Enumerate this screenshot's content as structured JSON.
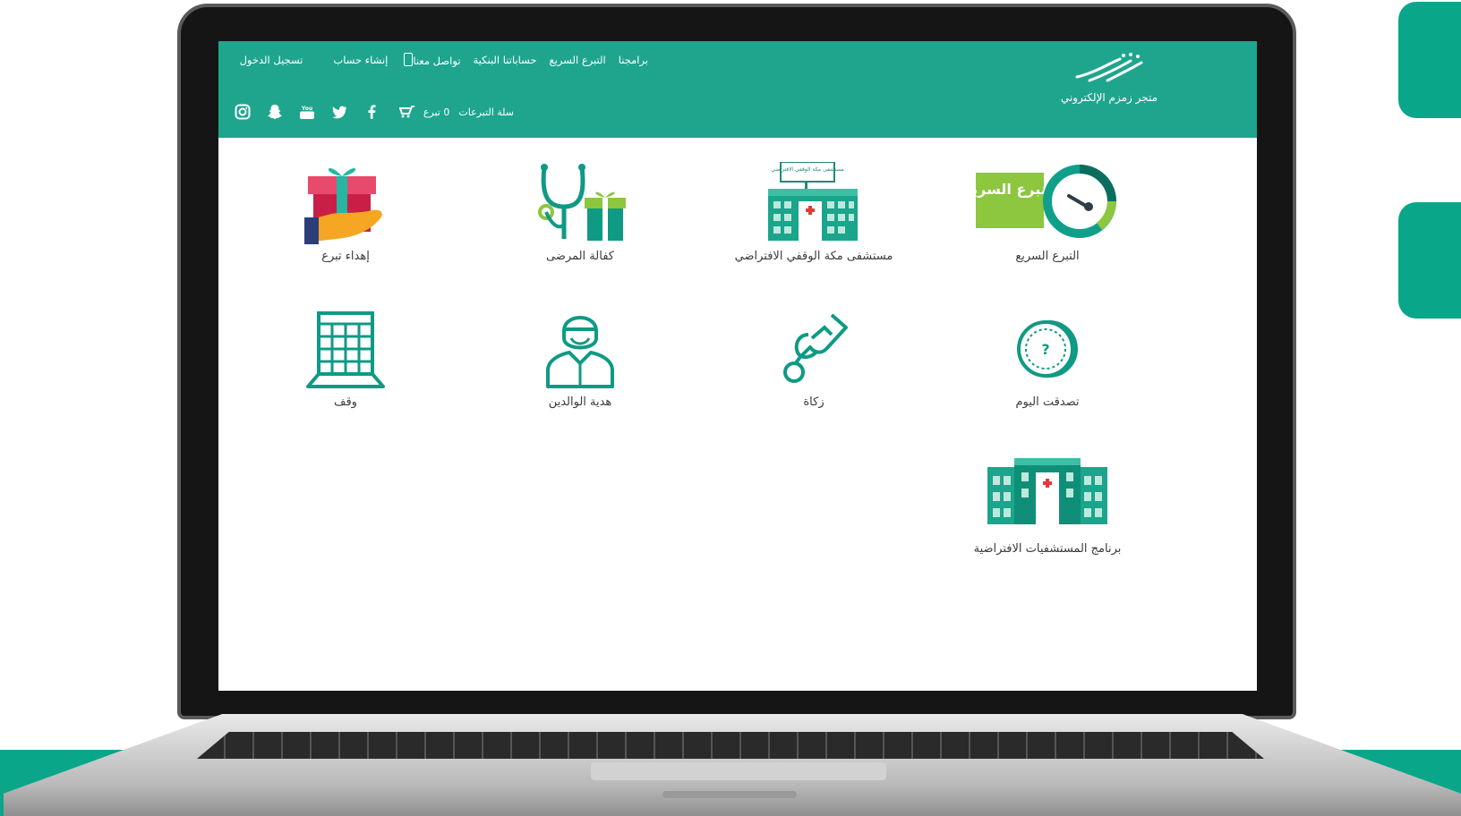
{
  "store": {
    "name": "متجر زمزم الإلكتروني"
  },
  "nav": {
    "items": [
      {
        "label": "برامجنا"
      },
      {
        "label": "التبرع السريع"
      },
      {
        "label": "حساباتنا البنكية"
      },
      {
        "label": "تواصل معنا"
      },
      {
        "label": "إنشاء حساب"
      },
      {
        "label": "تسجيل الدخول"
      }
    ]
  },
  "cart": {
    "label": "سلة التبرعات",
    "count": "0 تبرع"
  },
  "socials": [
    "instagram-icon",
    "snapchat-icon",
    "youtube-icon",
    "twitter-icon",
    "facebook-icon"
  ],
  "tiles": [
    {
      "label": "التبرع السريع",
      "badge": "التبرع السريع"
    },
    {
      "label": "مستشفى مكة الوقفي الافتراضي",
      "sign": "مستشفى مكة الوقفي الافتراضي"
    },
    {
      "label": "كفالة المرضى"
    },
    {
      "label": "إهداء تبرع"
    },
    {
      "label": "تصدقت اليوم"
    },
    {
      "label": "زكاة"
    },
    {
      "label": "هدية الوالدين"
    },
    {
      "label": "وقف"
    },
    {
      "label": "برنامج المستشفيات الافتراضية"
    }
  ],
  "colors": {
    "brand": "#1fa58e",
    "accent_green": "#8dc63f",
    "icon_teal": "#11a38b"
  }
}
